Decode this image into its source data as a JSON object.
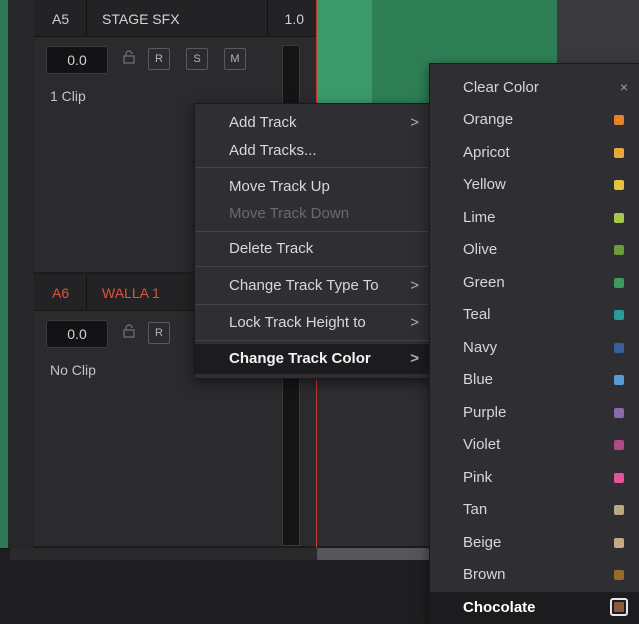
{
  "tracks": [
    {
      "num": "A5",
      "name": "STAGE SFX",
      "volume": "1.0",
      "gain": "0.0",
      "clips": "1 Clip",
      "name_color": "#d4d4d6"
    },
    {
      "num": "A6",
      "name": "WALLA 1",
      "gain": "0.0",
      "clips": "No Clip",
      "name_color": "#e0533c"
    }
  ],
  "track_buttons": {
    "r": "R",
    "s": "S",
    "m": "M"
  },
  "context_menu": {
    "items": [
      {
        "label": "Add Track",
        "submenu": true,
        "arrow": ">"
      },
      {
        "label": "Add Tracks..."
      },
      {
        "label": "Move Track Up"
      },
      {
        "label": "Move Track Down",
        "disabled": true
      },
      {
        "label": "Delete Track"
      },
      {
        "label": "Change Track Type To",
        "submenu": true,
        "arrow": ">"
      },
      {
        "label": "Lock Track Height to",
        "submenu": true,
        "arrow": ">"
      },
      {
        "label": "Change Track Color",
        "submenu": true,
        "arrow": ">",
        "active": true
      }
    ]
  },
  "color_menu": {
    "clear_label": "Clear Color",
    "close_glyph": "×",
    "colors": [
      {
        "label": "Orange",
        "hex": "#e8822a"
      },
      {
        "label": "Apricot",
        "hex": "#eaa83a"
      },
      {
        "label": "Yellow",
        "hex": "#e5c23a"
      },
      {
        "label": "Lime",
        "hex": "#a8c84a"
      },
      {
        "label": "Olive",
        "hex": "#6f9a3a"
      },
      {
        "label": "Green",
        "hex": "#3e9a5e"
      },
      {
        "label": "Teal",
        "hex": "#2a9a9a"
      },
      {
        "label": "Navy",
        "hex": "#3a5e9a"
      },
      {
        "label": "Blue",
        "hex": "#5a9ad6"
      },
      {
        "label": "Purple",
        "hex": "#8a6aaa"
      },
      {
        "label": "Violet",
        "hex": "#b04a86"
      },
      {
        "label": "Pink",
        "hex": "#e2559a"
      },
      {
        "label": "Tan",
        "hex": "#b8a886"
      },
      {
        "label": "Beige",
        "hex": "#c6a882"
      },
      {
        "label": "Brown",
        "hex": "#9a6a2a"
      },
      {
        "label": "Chocolate",
        "hex": "#8a5a3a",
        "active": true
      }
    ]
  }
}
